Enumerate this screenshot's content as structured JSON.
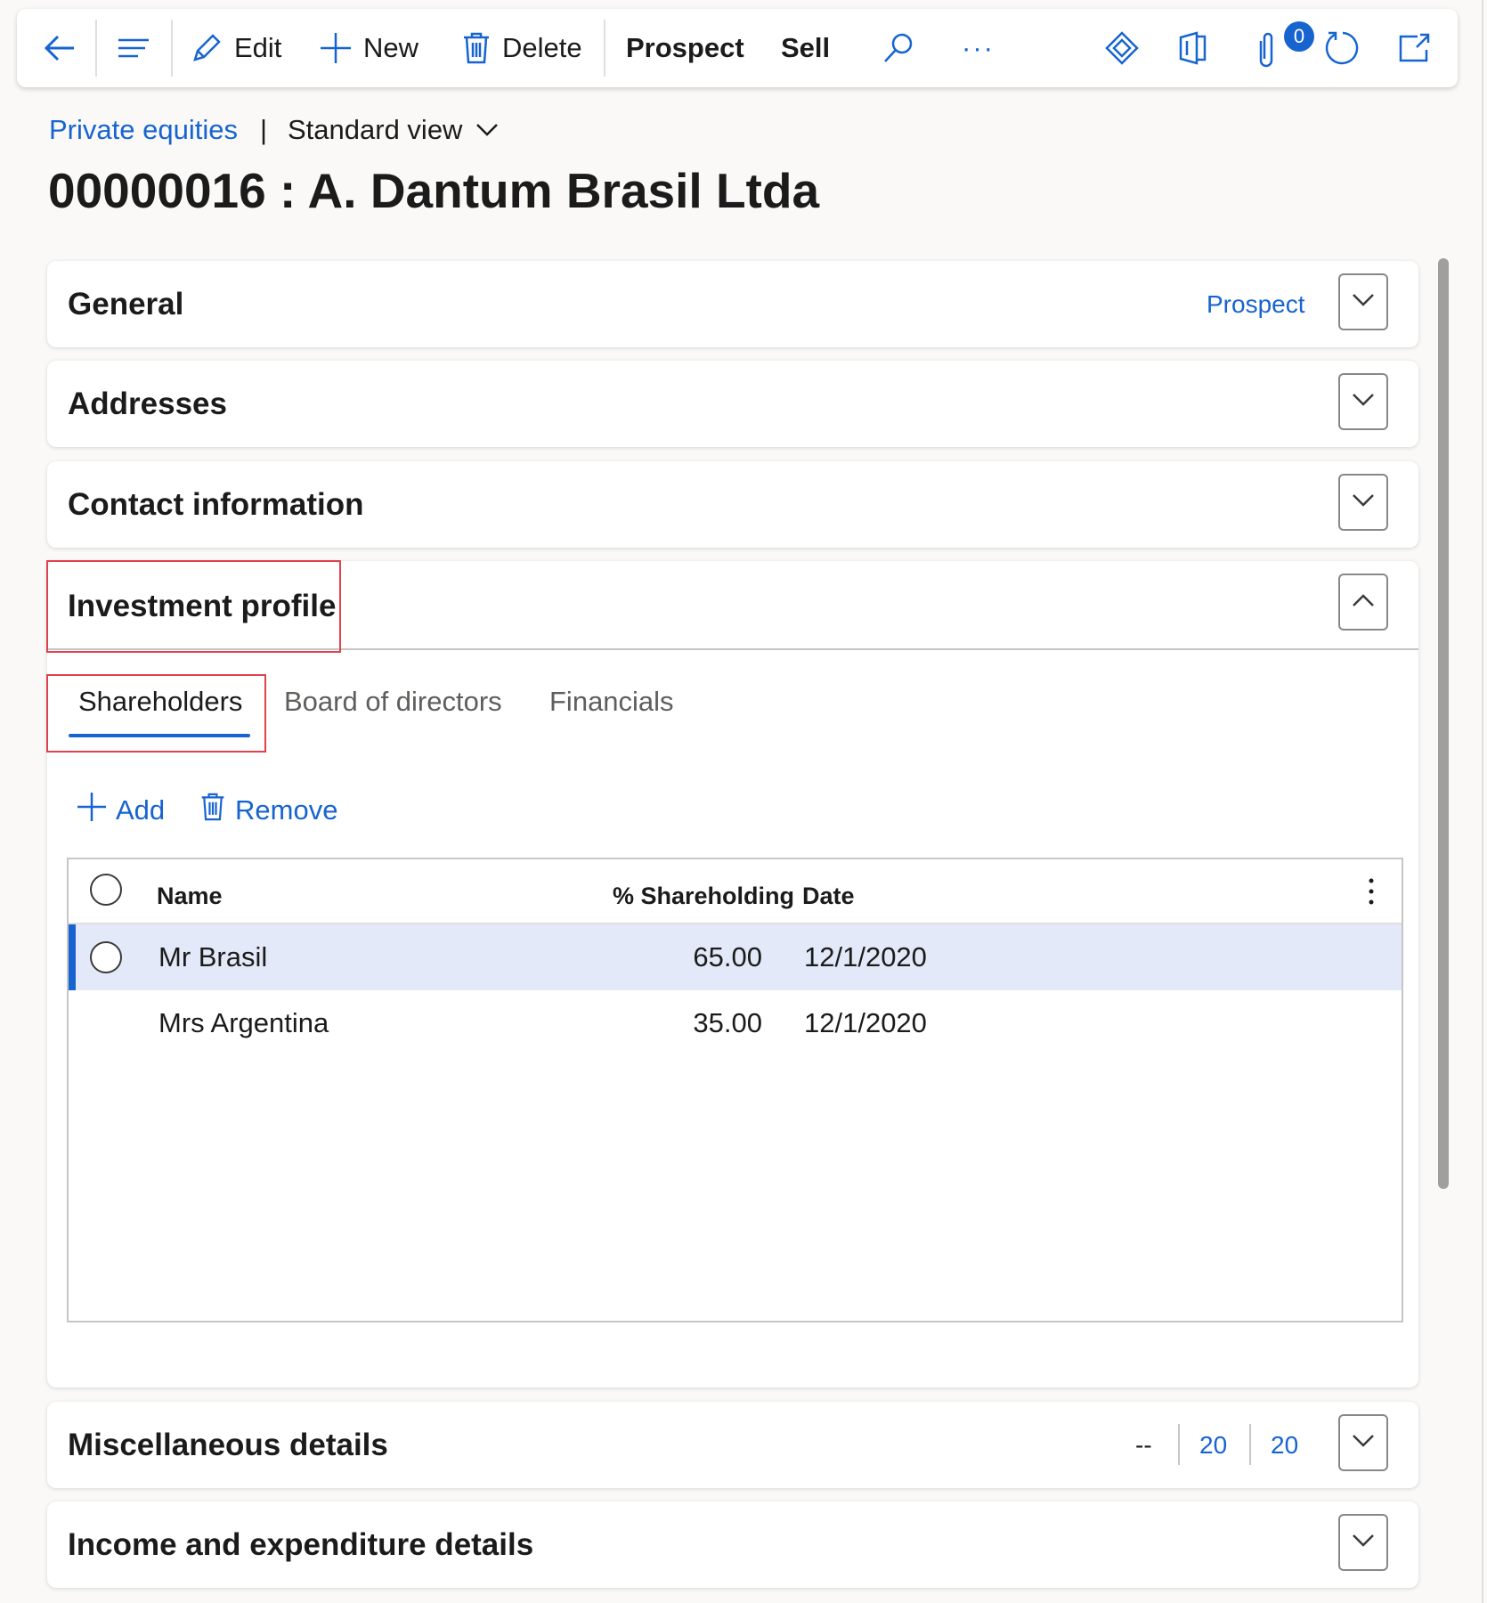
{
  "toolbar": {
    "edit_label": "Edit",
    "new_label": "New",
    "delete_label": "Delete",
    "prospect_label": "Prospect",
    "sell_label": "Sell",
    "more_label": "···",
    "attachments_count": "0"
  },
  "breadcrumb": {
    "link": "Private equities",
    "separator": "|",
    "view": "Standard view"
  },
  "page_title": "00000016 : A. Dantum Brasil Ltda",
  "sections": {
    "general": {
      "title": "General",
      "summary": "Prospect"
    },
    "addresses": {
      "title": "Addresses"
    },
    "contact": {
      "title": "Contact information"
    },
    "investment": {
      "title": "Investment profile",
      "tabs": [
        "Shareholders",
        "Board of directors",
        "Financials"
      ],
      "actions": {
        "add": "Add",
        "remove": "Remove"
      },
      "grid": {
        "columns": [
          "Name",
          "% Shareholding",
          "Date"
        ],
        "rows": [
          {
            "name": "Mr Brasil",
            "pct": "65.00",
            "date": "12/1/2020"
          },
          {
            "name": "Mrs Argentina",
            "pct": "35.00",
            "date": "12/1/2020"
          }
        ]
      }
    },
    "misc": {
      "title": "Miscellaneous details",
      "summary1": "--",
      "summary2": "20",
      "summary3": "20"
    },
    "income": {
      "title": "Income and expenditure details"
    }
  },
  "colors": {
    "accent": "#1764d0",
    "highlight": "#e3e9f8",
    "redbox": "#e0414c"
  }
}
